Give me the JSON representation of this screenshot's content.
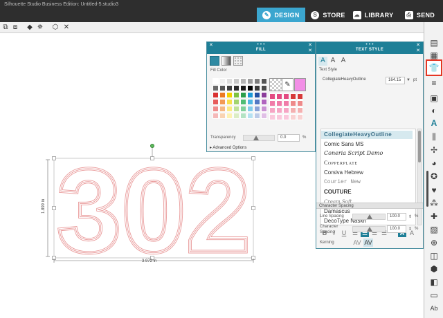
{
  "app": {
    "title": "Silhouette Studio Business Edition: Untitled-5.studio3",
    "nav": [
      {
        "label": "DESIGN",
        "icon": "design-icon",
        "active": true
      },
      {
        "label": "STORE",
        "icon": "store-icon",
        "active": false
      },
      {
        "label": "LIBRARY",
        "icon": "library-icon",
        "active": false
      },
      {
        "label": "SEND",
        "icon": "send-icon",
        "active": false
      }
    ]
  },
  "canvas": {
    "design_text": "302",
    "width_label": "3.972 in",
    "height_label": "1.899 in",
    "outline_color": "#e99a9a",
    "arrow_color": "#e53624"
  },
  "fill_panel": {
    "title": "FILL",
    "fill_color_label": "Fill Color",
    "transparency_label": "Transparency",
    "transparency_value": "0.0",
    "transparency_unit": "%",
    "advanced_label": "Advanced Options",
    "selected_color": "#f28ee6"
  },
  "text_style_panel": {
    "title": "TEXT STYLE",
    "text_style_label": "Text Style",
    "font_name": "CollegiateHeavyOutline",
    "font_size": "164.15",
    "font_unit": "pt",
    "fonts": [
      "CollegiateHeavyOutline",
      "Comic Sans MS",
      "Coneria Script Demo",
      "Copperplate",
      "Corsiva Hebrew",
      "Courier New",
      "COUTURE",
      "Cream Soft",
      "Damascus",
      "DecoType Naskh"
    ],
    "format_buttons": [
      "B",
      "I",
      "U"
    ],
    "character_spacing_label": "Character Spacing",
    "line_spacing_label": "Line Spacing",
    "line_spacing_value": "100.0",
    "character_spacing_row_label": "Character Spacing",
    "character_spacing_value": "100.0",
    "percent_unit": "%",
    "kerning_label": "Kerning",
    "kerning_glyph": "AV"
  }
}
